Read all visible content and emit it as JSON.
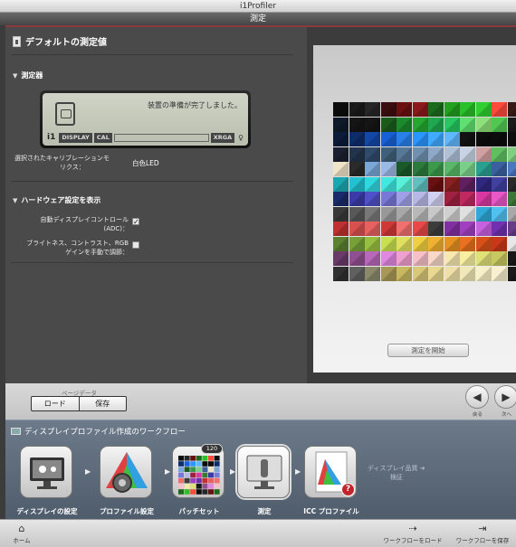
{
  "app": {
    "title": "i1Profiler"
  },
  "stepbar": {
    "active_step": "測定"
  },
  "left": {
    "title": "デフォルトの測定値",
    "section_device": "測定器",
    "lcd": {
      "message": "装置の準備が完了しました。",
      "logo": "i1",
      "tag_display": "DISPLAY",
      "tag_cal": "CAL",
      "tag_xrga": "XRGA",
      "bulb": "♀"
    },
    "calibration_mode_label_1": "選択されたキャリブレーションモ",
    "calibration_mode_label_2": "ード：",
    "calibration_mode_label_3": "リクス：",
    "calibration_mode_value": "白色LED",
    "section_hardware": "ハードウェア設定を表示",
    "adc_label_1": "自動ディスプレイコントロール",
    "adc_label_2": "(ADC)：",
    "adc_checked": true,
    "manual_label_1": "ブライトネス、コントラスト、RGB",
    "manual_label_2": "ゲインを手動で調節：",
    "manual_checked": false
  },
  "right": {
    "start_button": "測定を開始",
    "patch_colors": [
      [
        "#0c0c0c",
        "#1a1a1a",
        "#262626",
        "#3a0e0e",
        "#6a1010",
        "#8c1a1a",
        "#1c6a1c",
        "#22a020",
        "#2ac02a",
        "#30d030",
        "#ff4a3c",
        "#3a1a14"
      ],
      [
        "#0e1a2a",
        "#151515",
        "#151515",
        "#1c5a1c",
        "#1c8a2c",
        "#24a830",
        "#20a850",
        "#28c860",
        "#60e070",
        "#8ee07a",
        "#50c850",
        "#1a1a1a"
      ],
      [
        "#0a1c3a",
        "#0e2c6a",
        "#1448a8",
        "#1860d8",
        "#2880e8",
        "#2a96ff",
        "#40aaff",
        "#60b8ff",
        "#121212",
        "#0c0c0c",
        "#0c0c0c",
        "#0e0e0e"
      ],
      [
        "#1a2030",
        "#22344a",
        "#304a6c",
        "#40607a",
        "#587898",
        "#7090b0",
        "#90a8c8",
        "#b0c0d8",
        "#c8d4e4",
        "#d0a0a0",
        "#60c060",
        "#80d080"
      ],
      [
        "#f0e4c8",
        "#2a2a2a",
        "#7aa7d8",
        "#9cb8e4",
        "#1a5a2a",
        "#2c7a3c",
        "#3a9a4a",
        "#58b868",
        "#7ad08a",
        "#2aa090",
        "#3a60a0",
        "#4878c0"
      ],
      [
        "#1aa8b0",
        "#22c0d0",
        "#30d8e0",
        "#40e8e0",
        "#58f0d8",
        "#60c0c0",
        "#6a1010",
        "#8a2020",
        "#602060",
        "#302880",
        "#4040a0",
        "#2a2a2a"
      ],
      [
        "#1a2a6a",
        "#3a3aa8",
        "#5050c8",
        "#7878d8",
        "#a0a0e8",
        "#b8b8e8",
        "#d0d0f0",
        "#a02040",
        "#c02860",
        "#d838a0",
        "#e858c8",
        "#3a7838"
      ],
      [
        "#383838",
        "#585858",
        "#787878",
        "#989898",
        "#a8a8a8",
        "#b8b8b8",
        "#c8c8c8",
        "#d0d0d0",
        "#e0e0e0",
        "#30a8d8",
        "#50c0f0",
        "#a8a8a8"
      ],
      [
        "#c03030",
        "#d85050",
        "#e86060",
        "#d03838",
        "#f07070",
        "#e84848",
        "#3c3c3c",
        "#8030a0",
        "#a040c0",
        "#c860e0",
        "#7030b0",
        "#6a3a8a"
      ],
      [
        "#5a8030",
        "#78a038",
        "#98c040",
        "#c8e050",
        "#e0e060",
        "#f0d040",
        "#f0b030",
        "#e89020",
        "#e87020",
        "#d85018",
        "#c83818",
        "#e8e8e8"
      ],
      [
        "#6a3a6a",
        "#905090",
        "#b868b8",
        "#e088e0",
        "#f0a0d0",
        "#f8c0c8",
        "#f8d8c8",
        "#f8e8b0",
        "#f8f0a0",
        "#e0e078",
        "#c8c860",
        "#181818"
      ],
      [
        "#303030",
        "#606060",
        "#8a8a6a",
        "#a89858",
        "#c8b860",
        "#d8c878",
        "#e8d890",
        "#f0e0a8",
        "#f0e8b8",
        "#f8f0c8",
        "#f8f0d0",
        "#1a1a1a"
      ]
    ]
  },
  "pagedata": {
    "label": "ページデータ",
    "load": "ロード",
    "save": "保存",
    "back": "戻る",
    "next": "次へ",
    "back_glyph": "◀",
    "next_glyph": "▶"
  },
  "workflow": {
    "title": "ディスプレイプロファイル作成のワークフロー",
    "steps": [
      {
        "label": "ディスプレイの設定"
      },
      {
        "label": "プロファイル設定"
      },
      {
        "label": "パッチセット"
      },
      {
        "label": "測定"
      },
      {
        "label": "ICC プロファイル"
      }
    ],
    "patch_badge": "120",
    "quality_1": "ディスプレイ品質",
    "quality_2": "検証",
    "quality_arrow": "➔",
    "error_mark": "?"
  },
  "bottom": {
    "home": "ホーム",
    "load_workflow": "ワークフローをロード",
    "save_workflow": "ワークフローを保存"
  }
}
